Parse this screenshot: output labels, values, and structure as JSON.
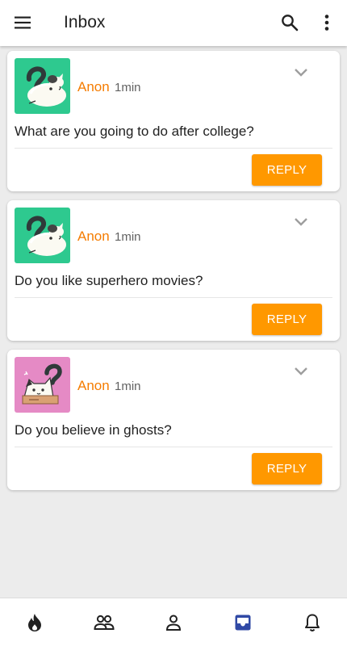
{
  "header": {
    "title": "Inbox",
    "icons": [
      "menu-icon",
      "search-icon",
      "more-vert-icon"
    ]
  },
  "questions": [
    {
      "sender": "Anon",
      "time": "1min",
      "text": "What are you going to do after college?",
      "reply_label": "REPLY",
      "avatar": {
        "icon": "cat-question-avatar",
        "background": "#2ec98f"
      }
    },
    {
      "sender": "Anon",
      "time": "1min",
      "text": "Do you like superhero movies?",
      "reply_label": "REPLY",
      "avatar": {
        "icon": "cat-question-avatar",
        "background": "#2ec98f"
      }
    },
    {
      "sender": "Anon",
      "time": "1min",
      "text": "Do you believe in ghosts?",
      "reply_label": "REPLY",
      "avatar": {
        "icon": "cat-box-avatar",
        "background": "#e58ac5"
      }
    }
  ],
  "bottom_nav": {
    "items": [
      "flame-icon",
      "people-icon",
      "person-icon",
      "inbox-icon",
      "bell-icon"
    ],
    "active": "inbox-icon"
  },
  "colors": {
    "accent": "#ff9800",
    "sender": "#f57c00",
    "active_nav": "#3049a5",
    "background": "#ececec"
  }
}
